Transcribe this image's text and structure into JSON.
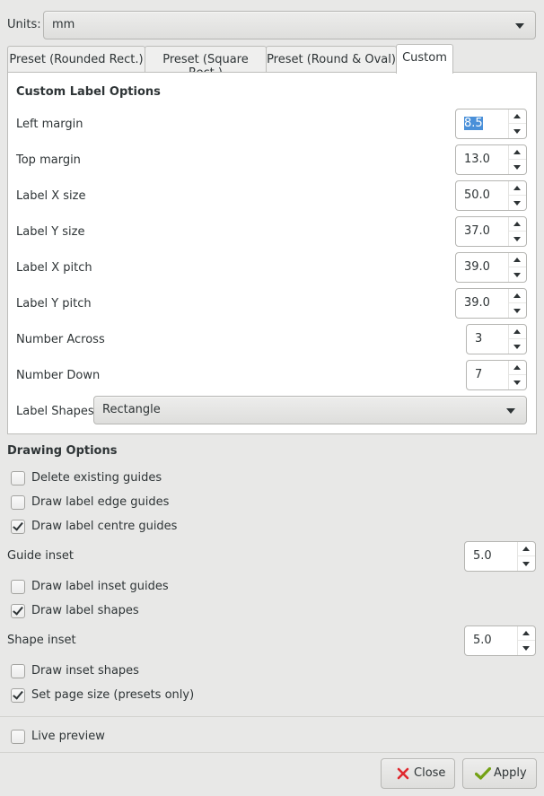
{
  "units": {
    "label": "Units:",
    "value": "mm"
  },
  "tabs": [
    {
      "label": "Preset (Rounded Rect.)",
      "active": false
    },
    {
      "label": "Preset (Square Rect.)",
      "active": false
    },
    {
      "label": "Preset (Round & Oval)",
      "active": false
    },
    {
      "label": "Custom",
      "active": true
    }
  ],
  "custom": {
    "heading": "Custom Label Options",
    "fields": [
      {
        "label": "Left margin",
        "value": "8.5",
        "selected": true
      },
      {
        "label": "Top margin",
        "value": "13.0"
      },
      {
        "label": "Label X size",
        "value": "50.0"
      },
      {
        "label": "Label Y size",
        "value": "37.0"
      },
      {
        "label": "Label X pitch",
        "value": "39.0"
      },
      {
        "label": "Label Y pitch",
        "value": "39.0"
      },
      {
        "label": "Number Across",
        "value": "3"
      },
      {
        "label": "Number Down",
        "value": "7"
      }
    ],
    "shapes": {
      "label": "Label Shapes:",
      "value": "Rectangle"
    }
  },
  "drawing": {
    "heading": "Drawing Options",
    "delete_guides": {
      "label": "Delete existing guides",
      "checked": false
    },
    "edge_guides": {
      "label": "Draw label edge guides",
      "checked": false
    },
    "centre_guides": {
      "label": "Draw label centre guides",
      "checked": true
    },
    "guide_inset": {
      "label": "Guide inset",
      "value": "5.0"
    },
    "inset_guides": {
      "label": "Draw label inset guides",
      "checked": false
    },
    "label_shapes": {
      "label": "Draw label shapes",
      "checked": true
    },
    "shape_inset": {
      "label": "Shape inset",
      "value": "5.0"
    },
    "inset_shapes": {
      "label": "Draw inset shapes",
      "checked": false
    },
    "page_size": {
      "label": "Set page size (presets only)",
      "checked": true
    }
  },
  "live_preview": {
    "label": "Live preview",
    "checked": false
  },
  "buttons": {
    "close": "Close",
    "apply": "Apply"
  },
  "colors": {
    "selection": "#4a90d9",
    "close_icon": "#e0282e",
    "apply_icon": "#73a114"
  }
}
